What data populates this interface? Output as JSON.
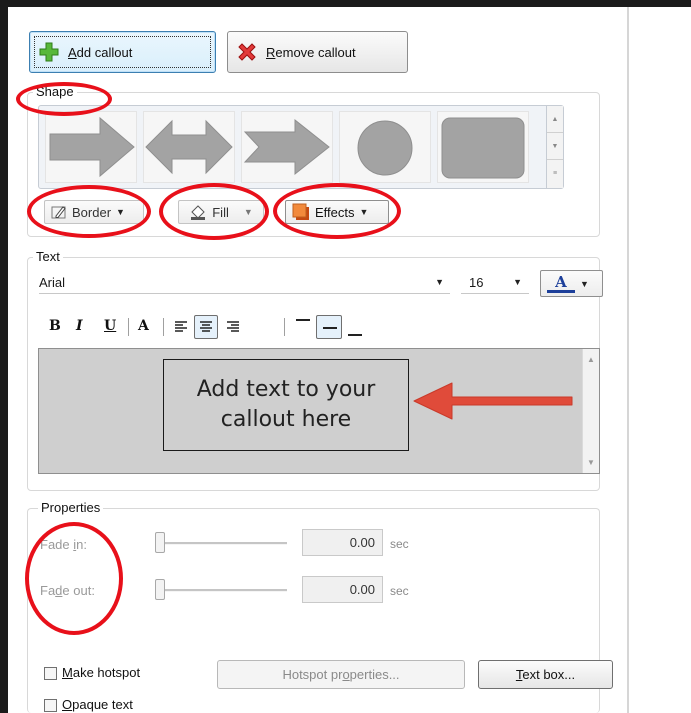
{
  "top_buttons": {
    "add_callout": {
      "accel": "A",
      "rest": "dd callout"
    },
    "remove_callout": {
      "accel": "R",
      "rest": "emove callout"
    }
  },
  "shape": {
    "group_title": "Shape",
    "gallery": [
      "arrow-right",
      "arrow-double",
      "chevron-arrow",
      "circle",
      "rounded-rectangle"
    ],
    "border_label": "Border",
    "fill_label": "Fill",
    "effects_label": "Effects"
  },
  "text": {
    "group_title": "Text",
    "font_name": "Arial",
    "font_size": "16",
    "font_color_glyph": "A",
    "format_buttons": {
      "bold": "B",
      "italic": "I",
      "underline": "U",
      "text_color": "A"
    },
    "content": "Add text to your callout here"
  },
  "properties": {
    "group_title": "Properties",
    "fade_in": {
      "label_pre": "Fade ",
      "accel": "i",
      "label_post": "n:",
      "value": "0.00",
      "unit": "sec"
    },
    "fade_out": {
      "label_pre": "Fa",
      "accel": "d",
      "label_post": "e out:",
      "value": "0.00",
      "unit": "sec"
    },
    "make_hotspot": {
      "accel": "M",
      "rest": "ake hotspot",
      "checked": false
    },
    "hotspot_properties": {
      "pre": "Hotspot pr",
      "accel": "o",
      "post": "perties..."
    },
    "text_box": {
      "accel": "T",
      "rest": "ext box..."
    },
    "opaque_text": {
      "accel": "O",
      "rest": "paque text",
      "checked": false
    }
  },
  "colors": {
    "annotation_red": "#e8101a",
    "callout_fill": "#cfcfcf",
    "arrow_gray": "#a3a3a3"
  }
}
